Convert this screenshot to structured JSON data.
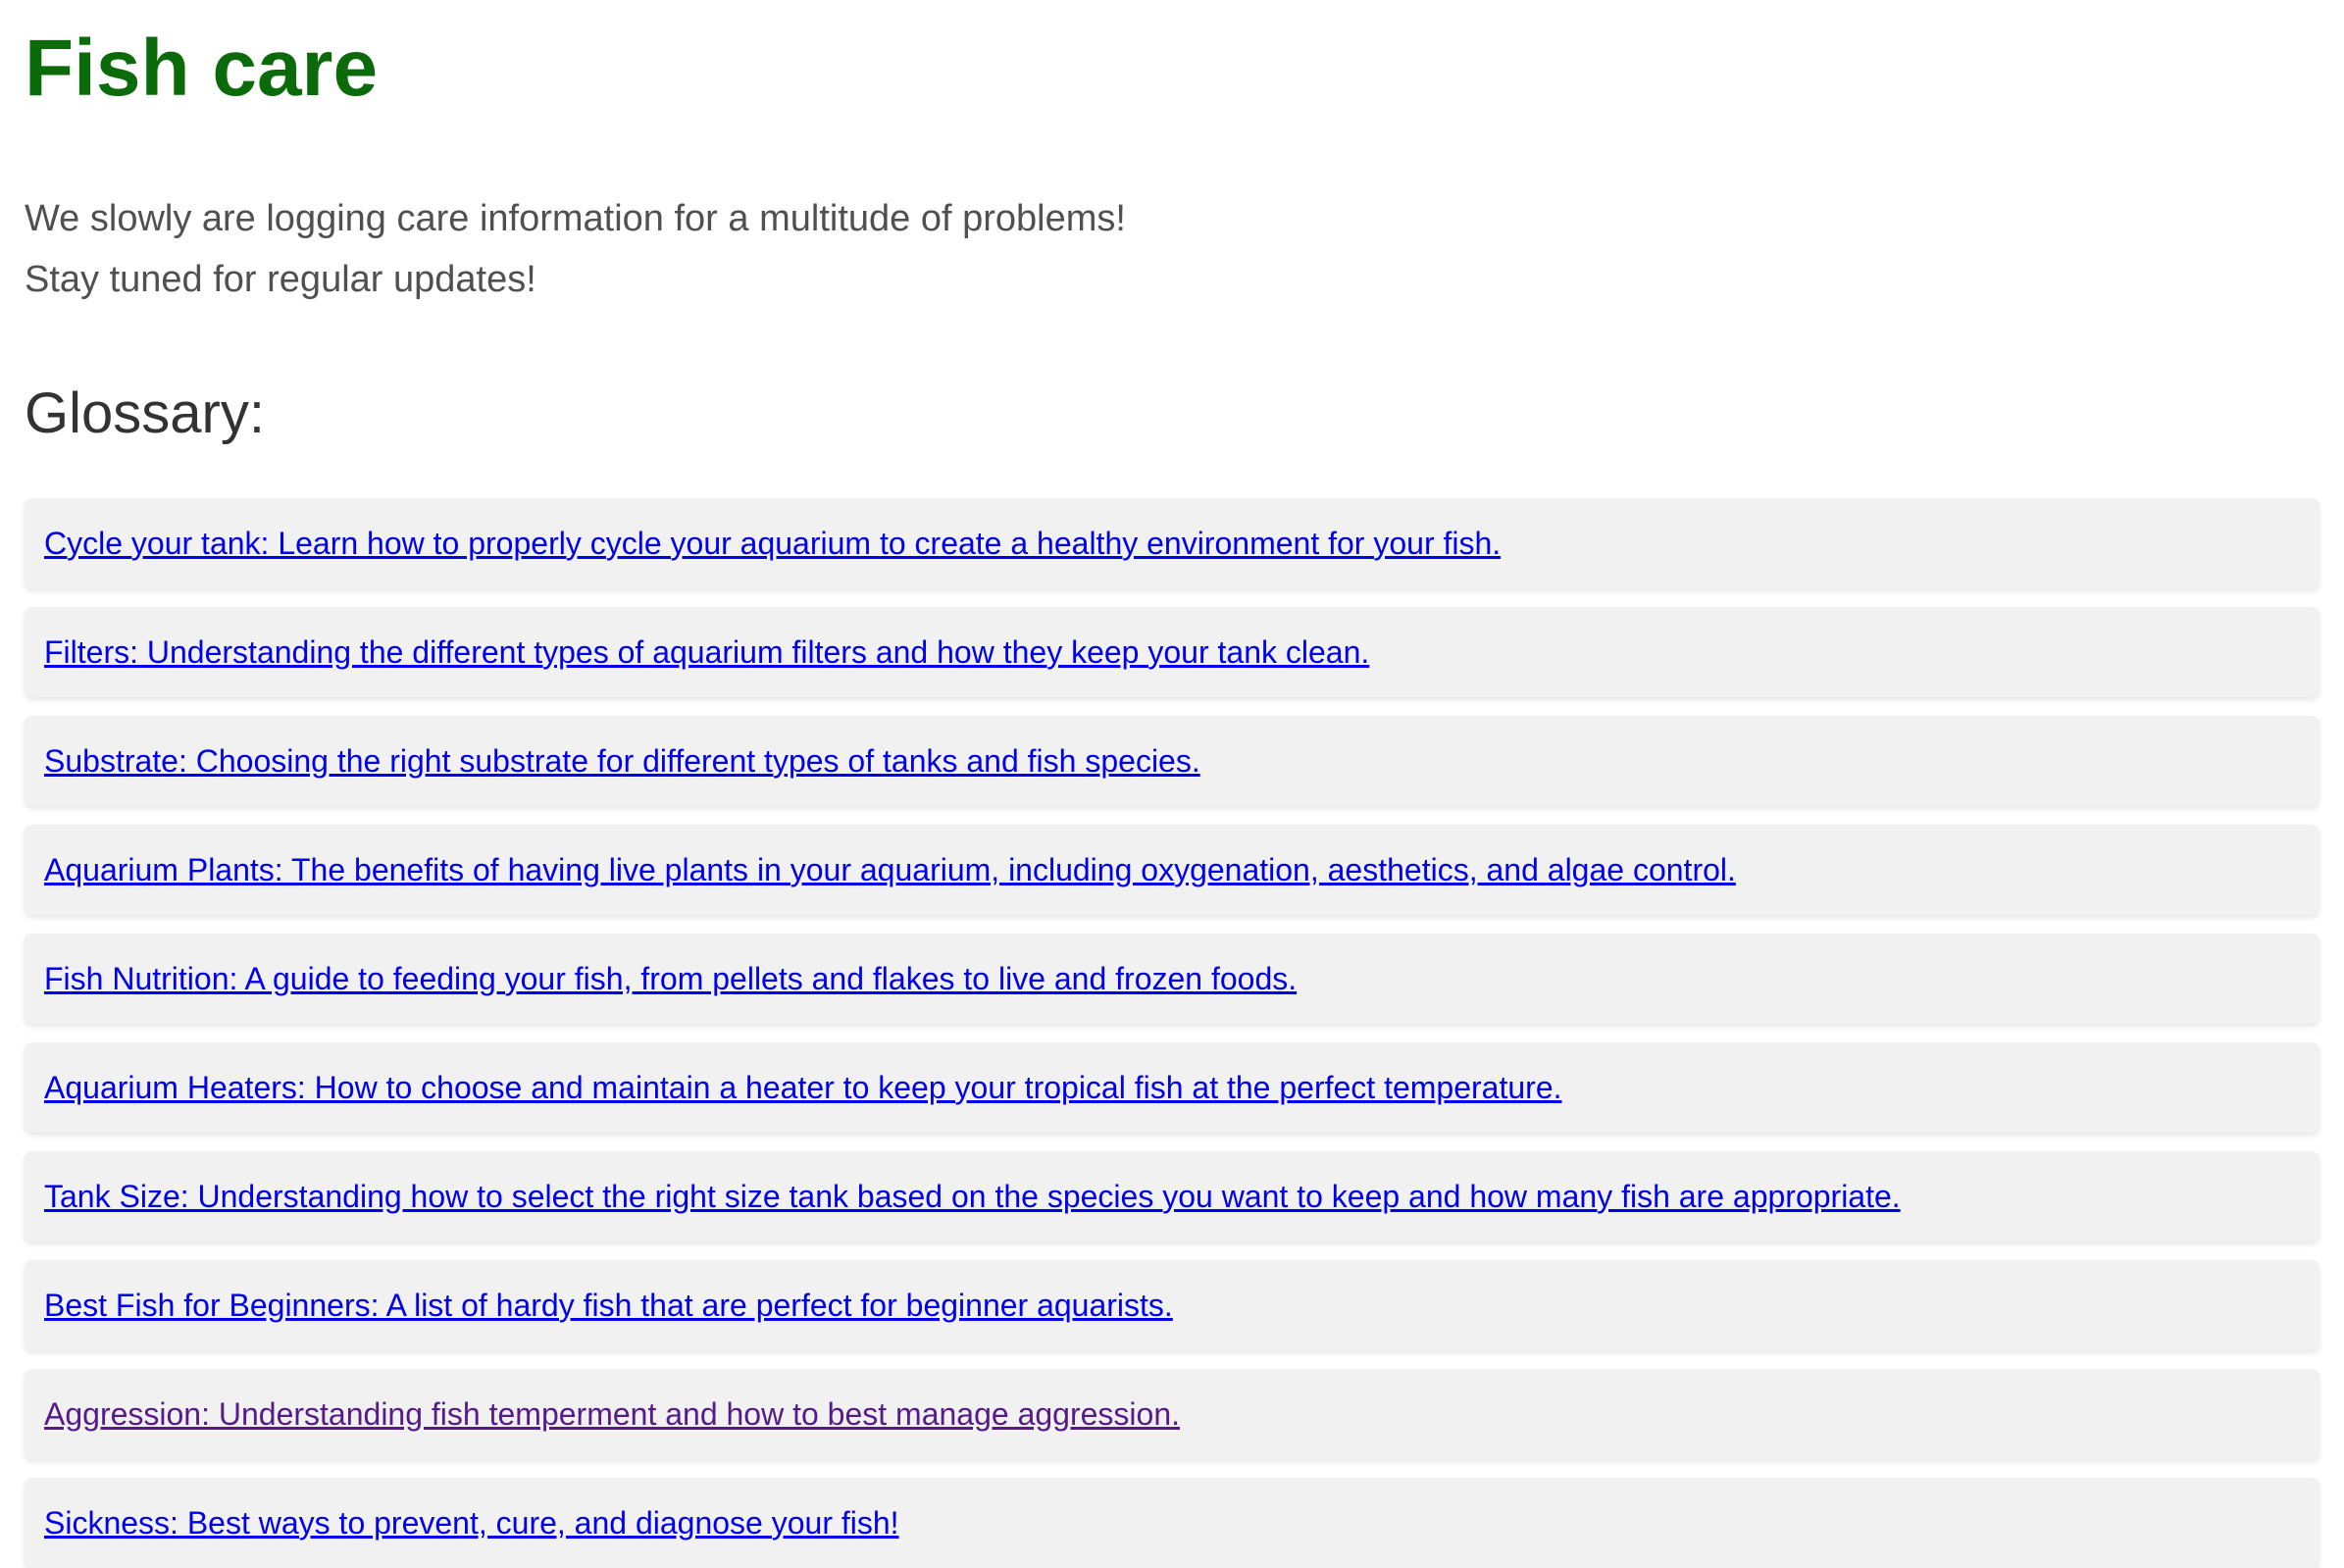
{
  "header": {
    "title": "Fish care"
  },
  "intro": {
    "line1": "We slowly are logging care information for a multitude of problems!",
    "line2": "Stay tuned for regular updates!"
  },
  "glossary": {
    "heading": "Glossary:",
    "items": [
      {
        "label": "Cycle your tank: Learn how to properly cycle your aquarium to create a healthy environment for your fish."
      },
      {
        "label": "Filters: Understanding the different types of aquarium filters and how they keep your tank clean."
      },
      {
        "label": "Substrate: Choosing the right substrate for different types of tanks and fish species."
      },
      {
        "label": "Aquarium Plants: The benefits of having live plants in your aquarium, including oxygenation, aesthetics, and algae control."
      },
      {
        "label": "Fish Nutrition: A guide to feeding your fish, from pellets and flakes to live and frozen foods."
      },
      {
        "label": "Aquarium Heaters: How to choose and maintain a heater to keep your tropical fish at the perfect temperature."
      },
      {
        "label": "Tank Size: Understanding how to select the right size tank based on the species you want to keep and how many fish are appropriate."
      },
      {
        "label": "Best Fish for Beginners: A list of hardy fish that are perfect for beginner aquarists."
      },
      {
        "label": "Aggression: Understanding fish temperment and how to best manage aggression."
      },
      {
        "label": "Sickness: Best ways to prevent, cure, and diagnose your fish!"
      }
    ]
  },
  "colors": {
    "title": "#0b6b0b",
    "link": "#0000ee",
    "link_visited": "#551a8b",
    "card_background": "#f1f1f1"
  }
}
